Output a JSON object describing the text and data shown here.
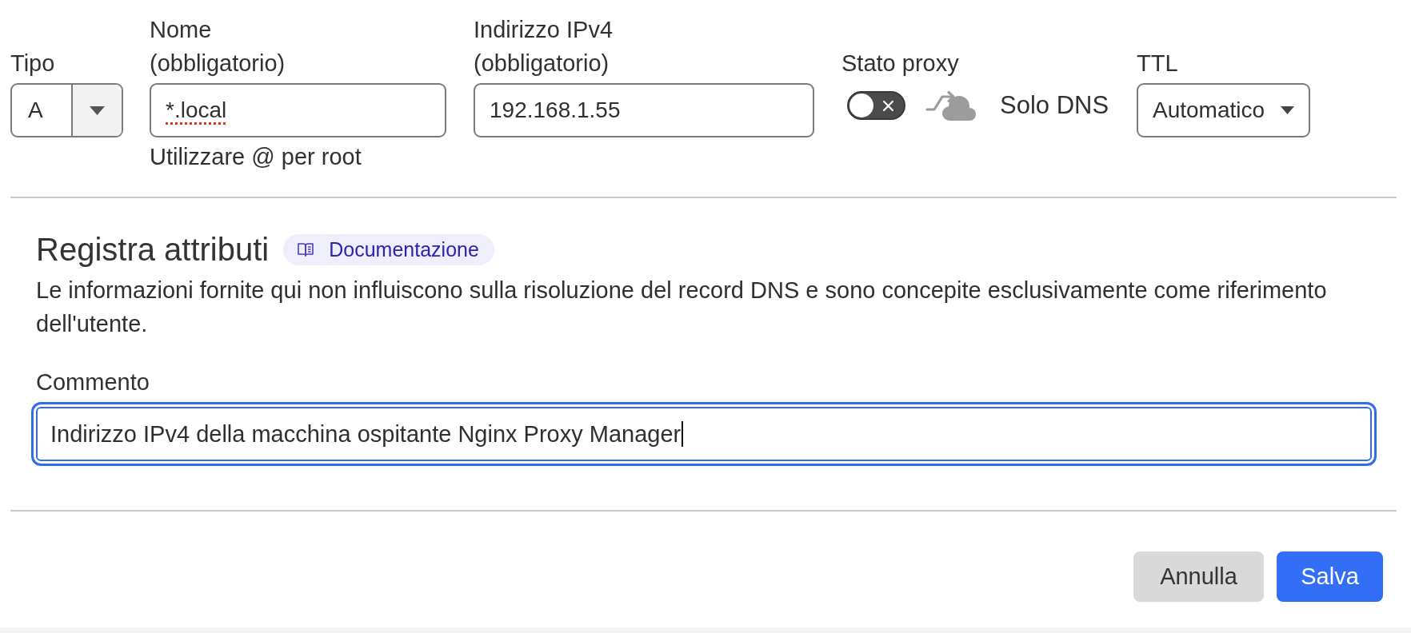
{
  "record": {
    "type": {
      "label": "Tipo",
      "value": "A"
    },
    "name": {
      "label": "Nome",
      "note": "(obbligatorio)",
      "value": "*.local",
      "spelling_error": true,
      "hint": "Utilizzare @ per root"
    },
    "ipv4": {
      "label": "Indirizzo IPv4",
      "note": "(obbligatorio)",
      "value": "192.168.1.55"
    },
    "proxy": {
      "label": "Stato proxy",
      "on": false,
      "status": "Solo DNS"
    },
    "ttl": {
      "label": "TTL",
      "value": "Automatico"
    }
  },
  "attributes": {
    "title": "Registra attributi",
    "doc_link": "Documentazione",
    "description": "Le informazioni fornite qui non influiscono sulla risoluzione del record DNS e sono concepite esclusivamente come riferimento dell'utente.",
    "comment": {
      "label": "Commento",
      "value": "Indirizzo IPv4 della macchina ospitante Nginx Proxy Manager",
      "focused": true
    }
  },
  "buttons": [
    {
      "label": "Annulla",
      "kind": "secondary"
    },
    {
      "label": "Salva",
      "kind": "primary"
    }
  ]
}
